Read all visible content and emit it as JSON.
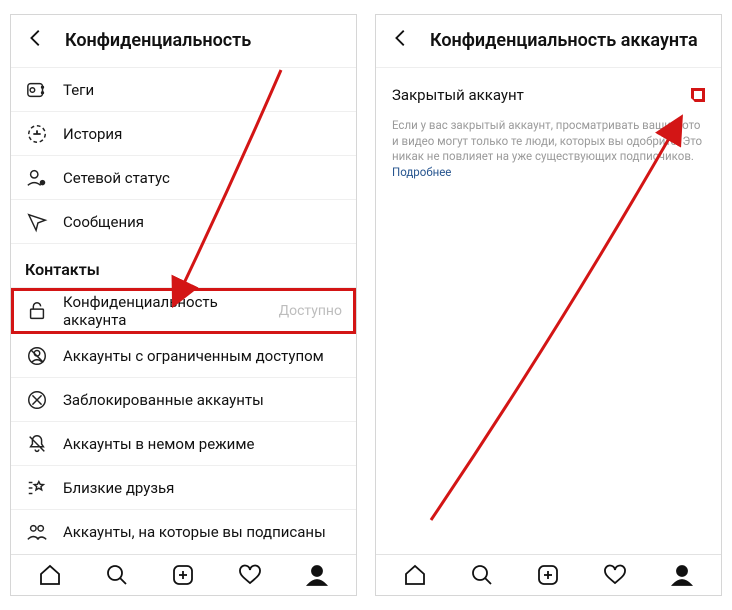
{
  "left": {
    "title": "Конфиденциальность",
    "items_top": [
      {
        "icon": "tag",
        "label": "Теги"
      },
      {
        "icon": "history",
        "label": "История"
      },
      {
        "icon": "status",
        "label": "Сетевой статус"
      },
      {
        "icon": "messages",
        "label": "Сообщения"
      }
    ],
    "section_title": "Контакты",
    "items_bottom": [
      {
        "icon": "lock",
        "label": "Конфиденциальность аккаунта",
        "trailing": "Доступно",
        "highlight": true
      },
      {
        "icon": "restrict",
        "label": "Аккаунты с ограниченным доступом"
      },
      {
        "icon": "block",
        "label": "Заблокированные аккаунты"
      },
      {
        "icon": "mute",
        "label": "Аккаунты в немом режиме"
      },
      {
        "icon": "close-friends",
        "label": "Близкие друзья"
      },
      {
        "icon": "following",
        "label": "Аккаунты, на которые вы подписаны"
      }
    ]
  },
  "right": {
    "title": "Конфиденциальность аккаунта",
    "toggle_label": "Закрытый аккаунт",
    "toggle_on": true,
    "desc": "Если у вас закрытый аккаунт, просматривать ваши фото и видео могут только те люди, которых вы одобрите. Это никак не повлияет на уже существующих подписчиков.",
    "more_label": "Подробнее"
  },
  "tabs": [
    "home",
    "search",
    "add",
    "like",
    "profile"
  ]
}
